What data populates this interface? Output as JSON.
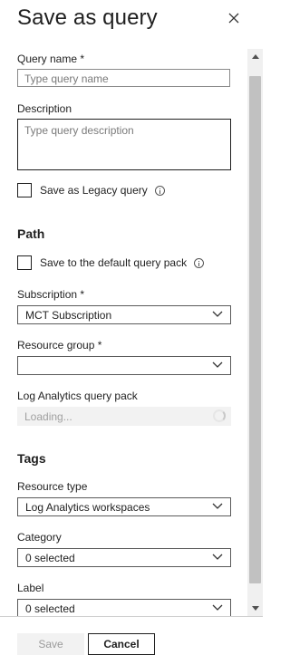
{
  "panel": {
    "title": "Save as query"
  },
  "form": {
    "query_name_label": "Query name *",
    "query_name_placeholder": "Type query name",
    "description_label": "Description",
    "description_placeholder": "Type query description",
    "legacy_checkbox_label": "Save as Legacy query",
    "path_section": "Path",
    "default_pack_checkbox_label": "Save to the default query pack",
    "subscription_label": "Subscription *",
    "subscription_value": "MCT Subscription",
    "resource_group_label": "Resource group *",
    "resource_group_value": "",
    "query_pack_label": "Log Analytics query pack",
    "query_pack_value": "Loading...",
    "tags_section": "Tags",
    "resource_type_label": "Resource type",
    "resource_type_value": "Log Analytics workspaces",
    "category_label": "Category",
    "category_value": "0 selected",
    "label_label": "Label",
    "label_value": "0 selected"
  },
  "footer": {
    "save_label": "Save",
    "cancel_label": "Cancel"
  },
  "icons": {
    "close": "close-icon",
    "info": "info-icon",
    "chevron": "chevron-down-icon",
    "spinner": "loading-spinner-icon"
  }
}
